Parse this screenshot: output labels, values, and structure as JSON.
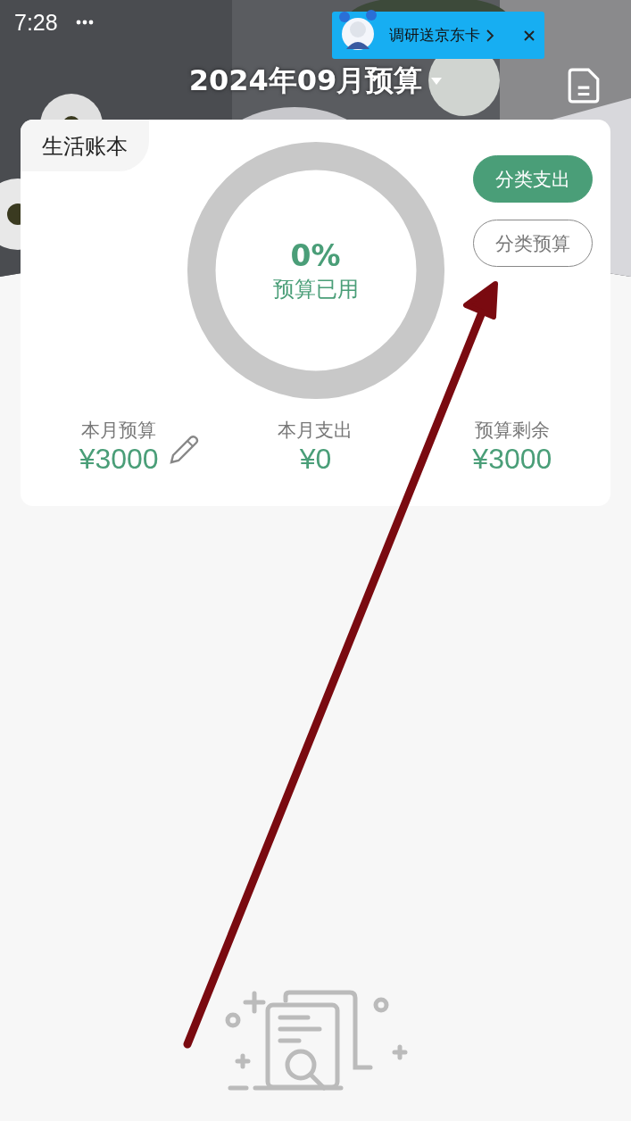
{
  "status_bar": {
    "time": "7:28"
  },
  "promo": {
    "text": "调研送京东卡"
  },
  "header": {
    "title": "2024年09月预算"
  },
  "card": {
    "book": "生活账本",
    "buttons": [
      {
        "label": "分类支出",
        "selected": true
      },
      {
        "label": "分类预算",
        "selected": false
      }
    ],
    "gauge": {
      "level": 0,
      "percent": "0%",
      "label": "预算已用"
    },
    "stats": [
      {
        "label": "本月预算",
        "value": "¥3000",
        "editable": true
      },
      {
        "label": "本月支出",
        "value": "¥0",
        "editable": false
      },
      {
        "label": "预算剩余",
        "value": "¥3000",
        "editable": false
      }
    ]
  }
}
